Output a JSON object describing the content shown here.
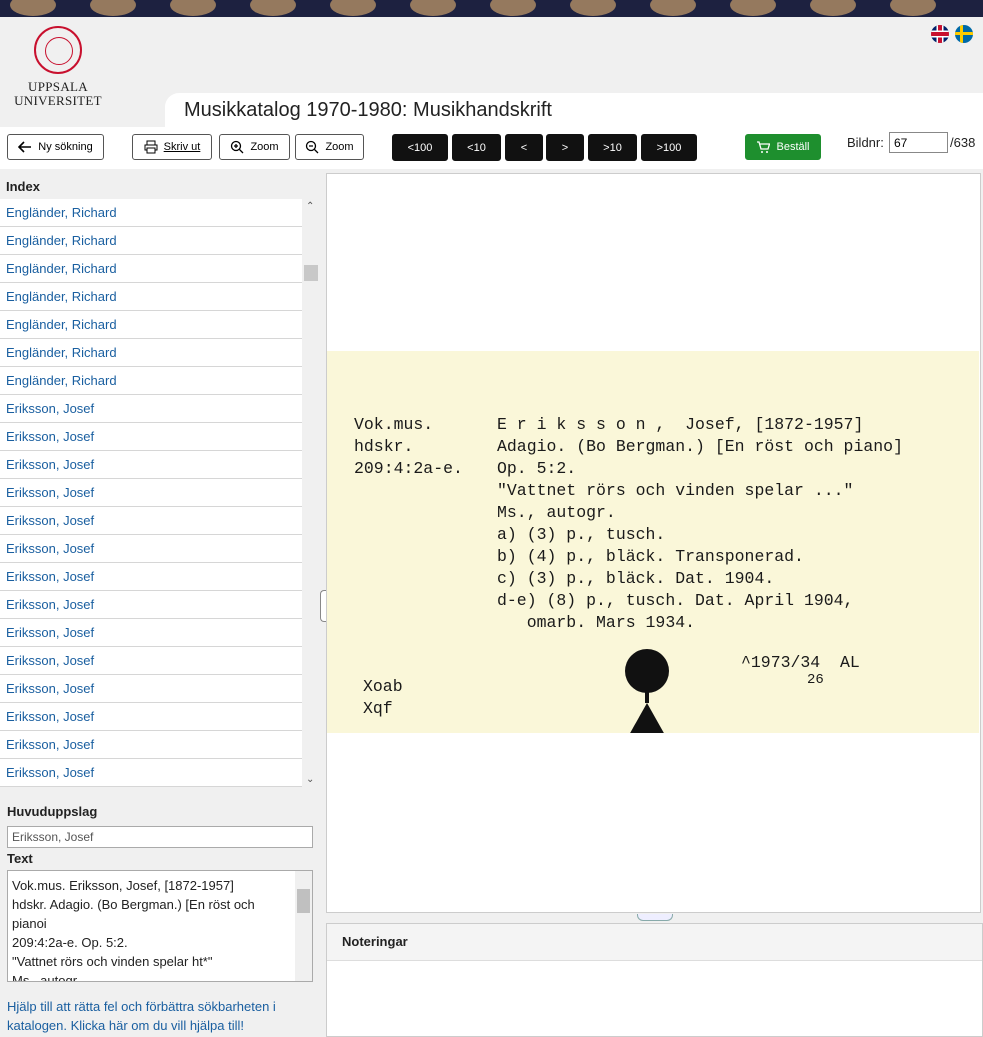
{
  "header": {
    "logo_line1": "UPPSALA",
    "logo_line2": "UNIVERSITET",
    "title": "Musikkatalog 1970-1980: Musikhandskrift",
    "languages": [
      "english-flag",
      "swedish-flag"
    ]
  },
  "toolbar": {
    "new_search": "Ny sökning",
    "print": "Skriv ut",
    "zoom_in": "Zoom",
    "zoom_out": "Zoom",
    "nav": [
      "<100",
      "<10",
      "<",
      ">",
      ">10",
      ">100"
    ],
    "order": "Beställ",
    "bildnr_label": "Bildnr:",
    "bildnr_value": "67",
    "bildnr_total": "/638"
  },
  "index": {
    "heading": "Index",
    "items": [
      "Engländer, Richard",
      "Engländer, Richard",
      "Engländer, Richard",
      "Engländer, Richard",
      "Engländer, Richard",
      "Engländer, Richard",
      "Engländer, Richard",
      "Eriksson, Josef",
      "Eriksson, Josef",
      "Eriksson, Josef",
      "Eriksson, Josef",
      "Eriksson, Josef",
      "Eriksson, Josef",
      "Eriksson, Josef",
      "Eriksson, Josef",
      "Eriksson, Josef",
      "Eriksson, Josef",
      "Eriksson, Josef",
      "Eriksson, Josef",
      "Eriksson, Josef",
      "Eriksson, Josef"
    ]
  },
  "details": {
    "huvuduppslag_label": "Huvuduppslag",
    "huvuduppslag_value": "Eriksson, Josef",
    "text_label": "Text",
    "text_lines": [
      "Vok.mus. Eriksson, Josef, [1872-1957]",
      "hdskr. Adagio. (Bo Bergman.) [En röst och",
      "pianoi",
      "209:4:2a-e. Op. 5:2.",
      "\"Vattnet rörs och vinden spelar ht*\"",
      "Ms., autogr."
    ],
    "help": "Hjälp till att rätta fel och förbättra sökbarheten i katalogen. Klicka här om du vill hjälpa till!"
  },
  "card": {
    "left_lines": [
      "Vok.mus.",
      "hdskr.",
      "209:4:2a-e."
    ],
    "main_lines": [
      "E r i k s s o n ,  Josef, [1872-1957]",
      "Adagio. (Bo Bergman.) [En röst och piano]",
      "Op. 5:2.",
      "\"Vattnet rörs och vinden spelar ...\"",
      "Ms., autogr.",
      "a) (3) p., tusch.",
      "b) (4) p., bläck. Transponerad.",
      "c) (3) p., bläck. Dat. 1904.",
      "d-e) (8) p., tusch. Dat. April 1904,",
      "   omarb. Mars 1934."
    ],
    "date_note": "^1973/34  AL",
    "date_sub": "26",
    "codes": [
      "Xoab",
      "Xqf"
    ]
  },
  "notes": {
    "heading": "Noteringar"
  }
}
